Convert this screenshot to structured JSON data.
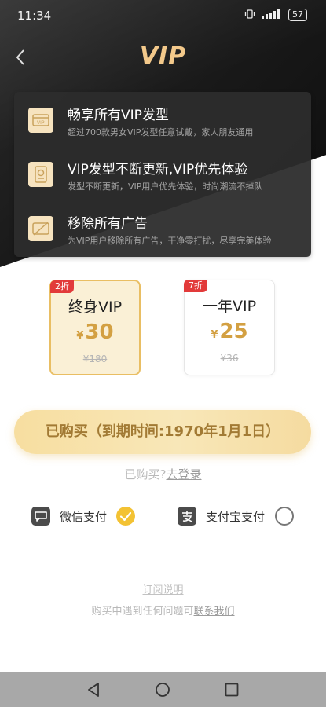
{
  "status_bar": {
    "time": "11:34",
    "battery": "57"
  },
  "header": {
    "title": "VIP",
    "back_icon": "chevron-left-icon"
  },
  "benefits": [
    {
      "title": "畅享所有VIP发型",
      "desc": "超过700款男女VIP发型任意试戴，家人朋友通用",
      "icon": "vip-card-icon"
    },
    {
      "title": "VIP发型不断更新,VIP优先体验",
      "desc": "发型不断更新，VIP用户优先体验，时尚潮流不掉队",
      "icon": "badge-icon"
    },
    {
      "title": "移除所有广告",
      "desc": "为VIP用户移除所有广告，干净零打扰，尽享完美体验",
      "icon": "no-ads-icon"
    }
  ],
  "plans": [
    {
      "badge": "2折",
      "name": "终身VIP",
      "currency": "¥",
      "price": "30",
      "original": "¥180",
      "selected": true
    },
    {
      "badge": "7折",
      "name": "一年VIP",
      "currency": "¥",
      "price": "25",
      "original": "¥36",
      "selected": false
    }
  ],
  "buy_button": {
    "label": "已购买（到期时间:1970年1月1日）"
  },
  "login": {
    "prefix": "已购买?",
    "link": "去登录"
  },
  "payment": {
    "wechat": {
      "label": "微信支付",
      "selected": true
    },
    "alipay": {
      "label": "支付宝支付",
      "selected": false
    }
  },
  "footer": {
    "subscription_link": "订阅说明",
    "help_prefix": "购买中遇到任何问题可",
    "contact_link": "联系我们"
  },
  "colors": {
    "accent_gold": "#f3c98b",
    "price_gold": "#d3a042",
    "discount_red": "#e23a3a",
    "check_yellow": "#f3c233"
  }
}
